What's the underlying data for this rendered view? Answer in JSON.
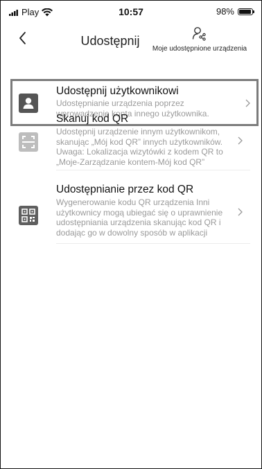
{
  "status_bar": {
    "carrier": "Play",
    "time": "10:57",
    "battery": "98%"
  },
  "nav": {
    "title": "Udostępnij",
    "shared_devices_label": "Moje udostępnione urządzenia"
  },
  "items": [
    {
      "title": "Udostępnij użytkownikowi",
      "description": "Udostępnianie urządzenia poprzez wprowadzenie konta innego użytkownika.",
      "icon": "user-icon",
      "selected": true
    },
    {
      "title": "Skanuj kod QR",
      "description": "Udostępnij urządzenie innym użytkownikom, skanując „Mój kod QR” innych użytkowników. Uwaga: Lokalizacja wizytówki z kodem QR to „Moje-Zarządzanie kontem-Mój kod QR”",
      "icon": "scan-qr-icon",
      "selected": false
    },
    {
      "title": "Udostępnianie przez kod QR",
      "description": "Wygenerowanie kodu QR urządzenia Inni użytkownicy mogą ubiegać się o uprawnienie udostępniania urządzenia skanując kod QR i dodając go w dowolny sposób w aplikacji",
      "icon": "qr-code-icon",
      "selected": false
    }
  ]
}
